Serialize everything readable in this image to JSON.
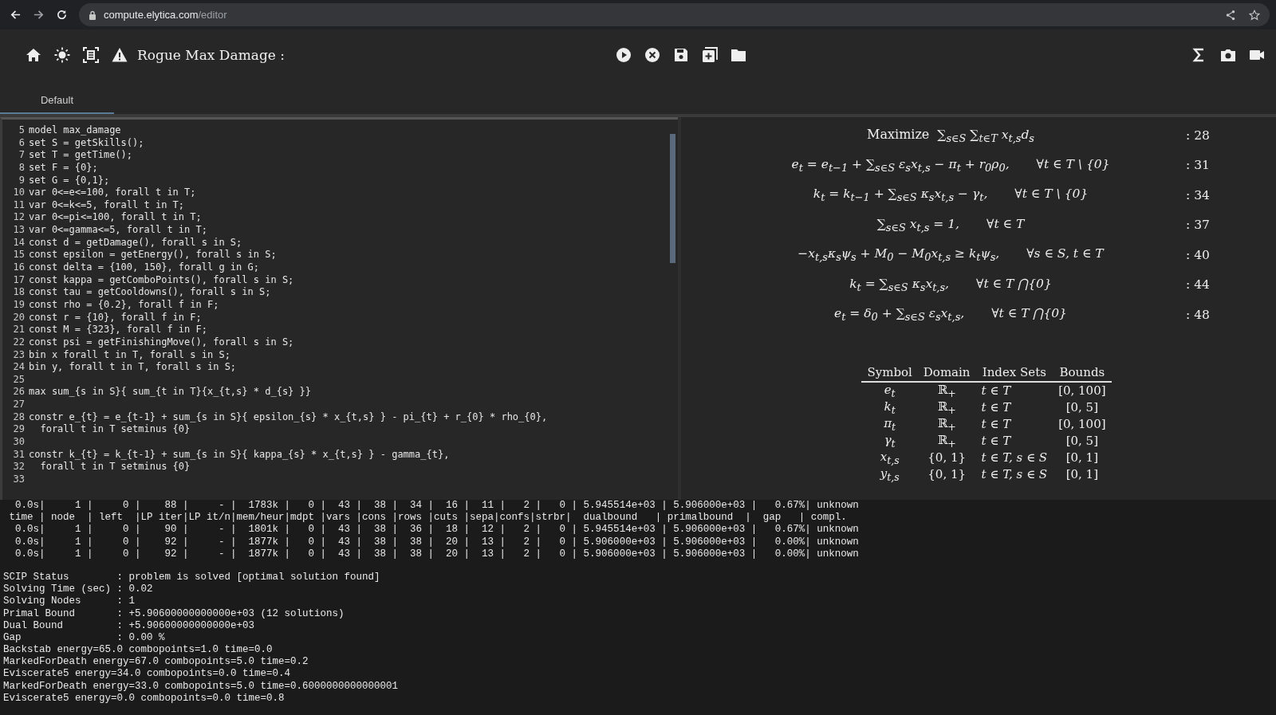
{
  "browser": {
    "url_host": "compute.elytica.com",
    "url_path": "/editor"
  },
  "toolbar": {
    "title": "Rogue Max Damage :"
  },
  "tabs": [
    {
      "label": "Default",
      "selected": true
    }
  ],
  "editor": {
    "lines": [
      {
        "number": "5",
        "text": "model max_damage"
      },
      {
        "number": "6",
        "text": "set S = getSkills();"
      },
      {
        "number": "7",
        "text": "set T = getTime();"
      },
      {
        "number": "8",
        "text": "set F = {0};"
      },
      {
        "number": "9",
        "text": "set G = {0,1};"
      },
      {
        "number": "10",
        "text": "var 0<=e<=100, forall t in T;"
      },
      {
        "number": "11",
        "text": "var 0<=k<=5, forall t in T;"
      },
      {
        "number": "12",
        "text": "var 0<=pi<=100, forall t in T;"
      },
      {
        "number": "13",
        "text": "var 0<=gamma<=5, forall t in T;"
      },
      {
        "number": "14",
        "text": "const d = getDamage(), forall s in S;"
      },
      {
        "number": "15",
        "text": "const epsilon = getEnergy(), forall s in S;"
      },
      {
        "number": "16",
        "text": "const delta = {100, 150}, forall g in G;"
      },
      {
        "number": "17",
        "text": "const kappa = getComboPoints(), forall s in S;"
      },
      {
        "number": "18",
        "text": "const tau = getCooldowns(), forall s in S;"
      },
      {
        "number": "19",
        "text": "const rho = {0.2}, forall f in F;"
      },
      {
        "number": "20",
        "text": "const r = {10}, forall f in F;"
      },
      {
        "number": "21",
        "text": "const M = {323}, forall f in F;"
      },
      {
        "number": "22",
        "text": "const psi = getFinishingMove(), forall s in S;"
      },
      {
        "number": "23",
        "text": "bin x forall t in T, forall s in S;"
      },
      {
        "number": "24",
        "text": "bin y, forall t in T, forall s in S;"
      },
      {
        "number": "25"
      },
      {
        "number": "26",
        "text": "max sum_{s in S}{ sum_{t in T}{x_{t,s} * d_{s} }}"
      },
      {
        "number": "27"
      },
      {
        "number": "28",
        "text": "constr e_{t} = e_{t-1} + sum_{s in S}{ epsilon_{s} * x_{t,s} } - pi_{t} + r_{0} * rho_{0},"
      },
      {
        "number": "29",
        "text": "  forall t in T setminus {0}"
      },
      {
        "number": "30"
      },
      {
        "number": "31",
        "text": "constr k_{t} = k_{t-1} + sum_{s in S}{ kappa_{s} * x_{t,s} } - gamma_{t},"
      },
      {
        "number": "32",
        "text": "  forall t in T setminus {0}"
      },
      {
        "number": "33"
      }
    ]
  },
  "formulas": [
    {
      "label": "Maximize",
      "expression": "∑$_{s∈S}$ ∑$_{t∈T}$ x$_{t,s}$d$_{s}$",
      "ref": ": 28"
    },
    {
      "expression": "e$_{t}$ = e$_{t−1}$ + ∑$_{s∈S}$ ε$_{s}$x$_{t,s}$ − π$_{t}$ + r$_{0}$ρ$_{0}$,",
      "condition": "∀t ∈ T \\ {0}",
      "ref": ": 31"
    },
    {
      "expression": "k$_{t}$ = k$_{t−1}$ + ∑$_{s∈S}$ κ$_{s}$x$_{t,s}$ − γ$_{t}$,",
      "condition": "∀t ∈ T \\ {0}",
      "ref": ": 34"
    },
    {
      "expression": "∑$_{s∈S}$ x$_{t,s}$ = 1,",
      "condition": "∀t ∈ T",
      "ref": ": 37"
    },
    {
      "expression": "−x$_{t,s}$κ$_{s}$ψ$_{s}$ + M$_{0}$ − M$_{0}$x$_{t,s}$ ≥ k$_{t}$ψ$_{s}$,",
      "condition": "∀s ∈ S, t ∈ T",
      "ref": ": 40"
    },
    {
      "expression": "k$_{t}$ = ∑$_{s∈S}$ κ$_{s}$x$_{t,s}$,",
      "condition": "∀t ∈ T ⋂{0}",
      "ref": ": 44"
    },
    {
      "expression": "e$_{t}$ = δ$_{0}$ + ∑$_{s∈S}$ ε$_{s}$x$_{t,s}$,",
      "condition": "∀t ∈ T ⋂{0}",
      "ref": ": 48"
    }
  ],
  "variables_table": {
    "columns": [
      "Symbol",
      "Domain",
      "Index Sets",
      "Bounds"
    ],
    "rows": [
      [
        "e$_{t}$",
        "ℝ$_{+}$",
        "t ∈ T",
        "[0, 100]"
      ],
      [
        "k$_{t}$",
        "ℝ$_{+}$",
        "t ∈ T",
        "[0, 5]"
      ],
      [
        "π$_{t}$",
        "ℝ$_{+}$",
        "t ∈ T",
        "[0, 100]"
      ],
      [
        "γ$_{t}$",
        "ℝ$_{+}$",
        "t ∈ T",
        "[0, 5]"
      ],
      [
        "x$_{t,s}$",
        "{0, 1}",
        "t ∈ T, s ∈ S",
        "[0, 1]"
      ],
      [
        "y$_{t,s}$",
        "{0, 1}",
        "t ∈ T, s ∈ S",
        "[0, 1]"
      ]
    ]
  },
  "console": {
    "table_lines": [
      "  0.0s|     1 |     0 |    88 |     - |  1783k |   0 |  43 |  38 |  34 |  16 |  11 |   2 |   0 | 5.945514e+03 | 5.906000e+03 |   0.67%| unknown",
      " time | node  | left  |LP iter|LP it/n|mem/heur|mdpt |vars |cons |rows |cuts |sepa|confs|strbr|  dualbound   | primalbound  |  gap   | compl.",
      "  0.0s|     1 |     0 |    90 |     - |  1801k |   0 |  43 |  38 |  36 |  18 |  12 |   2 |   0 | 5.945514e+03 | 5.906000e+03 |   0.67%| unknown",
      "  0.0s|     1 |     0 |    92 |     - |  1877k |   0 |  43 |  38 |  38 |  20 |  13 |   2 |   0 | 5.906000e+03 | 5.906000e+03 |   0.00%| unknown",
      "  0.0s|     1 |     0 |    92 |     - |  1877k |   0 |  43 |  38 |  38 |  20 |  13 |   2 |   0 | 5.906000e+03 | 5.906000e+03 |   0.00%| unknown"
    ],
    "log_lines": [
      "SCIP Status        : problem is solved [optimal solution found]",
      "Solving Time (sec) : 0.02",
      "Solving Nodes      : 1",
      "Primal Bound       : +5.90600000000000e+03 (12 solutions)",
      "Dual Bound         : +5.90600000000000e+03",
      "Gap                : 0.00 %",
      "Backstab energy=65.0 combopoints=1.0 time=0.0",
      "MarkedForDeath energy=67.0 combopoints=5.0 time=0.2",
      "Eviscerate5 energy=34.0 combopoints=0.0 time=0.4",
      "MarkedForDeath energy=33.0 combopoints=5.0 time=0.6000000000000001",
      "Eviscerate5 energy=0.0 combopoints=0.0 time=0.8"
    ]
  }
}
